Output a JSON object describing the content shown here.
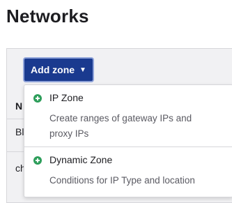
{
  "page": {
    "title": "Networks"
  },
  "toolbar": {
    "add_zone_label": "Add zone",
    "add_zone_caret": "▼"
  },
  "table": {
    "header_first_col": "N",
    "rows": [
      "Bl",
      "ch"
    ]
  },
  "dropdown": {
    "items": [
      {
        "title": "IP Zone",
        "description": "Create ranges of gateway IPs and proxy IPs",
        "icon": "plus-circle-icon"
      },
      {
        "title": "Dynamic Zone",
        "description": "Conditions for IP Type and location",
        "icon": "plus-circle-icon"
      }
    ]
  },
  "colors": {
    "button_bg": "#1a3a8f",
    "icon_green": "#2e9e5b"
  }
}
